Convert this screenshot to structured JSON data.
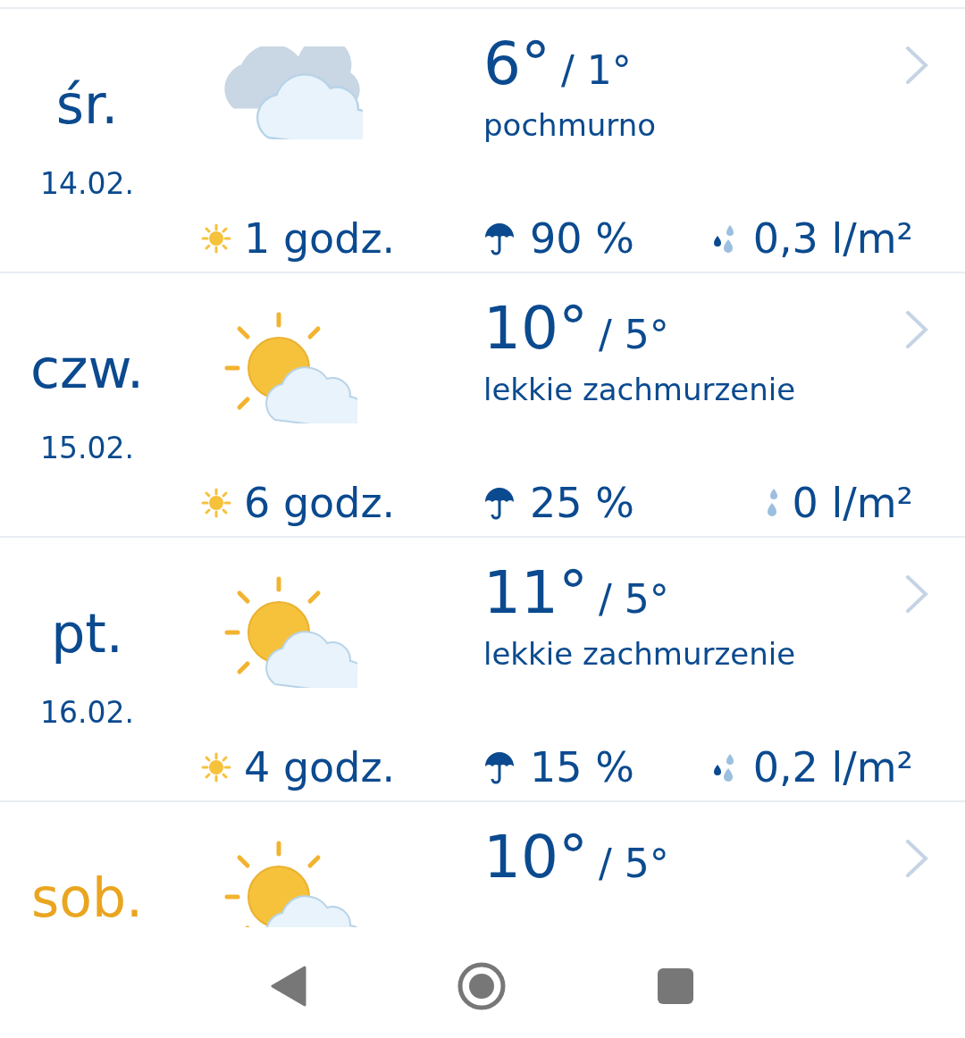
{
  "days": [
    {
      "day": "śr.",
      "date": "14.02.",
      "weekend": false,
      "kind": "cloudy",
      "high": "6°",
      "low": "/ 1°",
      "condition": "pochmurno",
      "sun_hours": "1 godz.",
      "rain_chance": "90 %",
      "rain_amount": "0,3 l/m²",
      "rain_drops": true
    },
    {
      "day": "czw.",
      "date": "15.02.",
      "weekend": false,
      "kind": "partly-sunny",
      "high": "10°",
      "low": "/ 5°",
      "condition": "lekkie zachmurzenie",
      "sun_hours": "6 godz.",
      "rain_chance": "25 %",
      "rain_amount": "0 l/m²",
      "rain_drops": false
    },
    {
      "day": "pt.",
      "date": "16.02.",
      "weekend": false,
      "kind": "partly-sunny",
      "high": "11°",
      "low": "/ 5°",
      "condition": "lekkie zachmurzenie",
      "sun_hours": "4 godz.",
      "rain_chance": "15 %",
      "rain_amount": "0,2 l/m²",
      "rain_drops": true
    },
    {
      "day": "sob.",
      "weekend": true,
      "kind": "partly-sunny",
      "high": "10°",
      "low": "/ 5°"
    }
  ]
}
